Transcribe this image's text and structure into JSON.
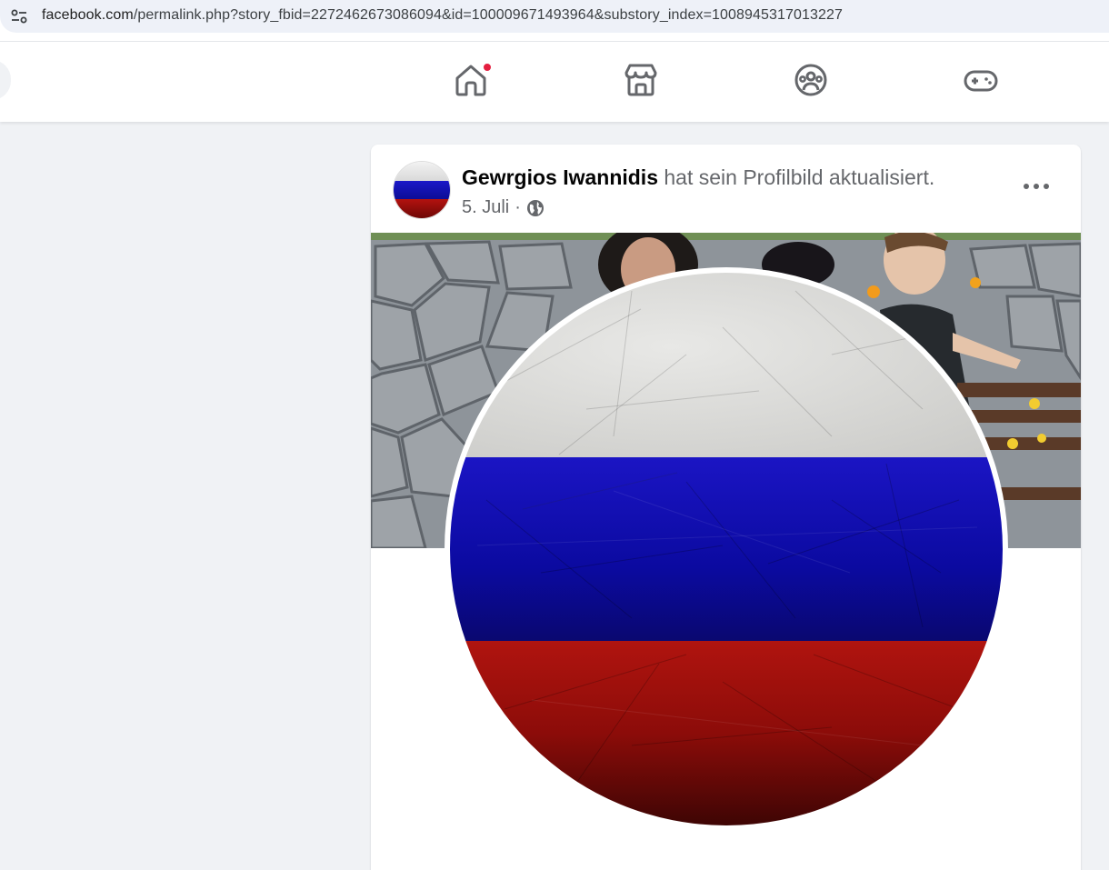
{
  "browser": {
    "url_host": "facebook.com",
    "url_path": "/permalink.php?story_fbid=2272462673086094&id=100009671493964&substory_index=1008945317013227",
    "site_info_icon": "tune-icon"
  },
  "nav": {
    "items": [
      {
        "name": "home",
        "icon": "home-icon",
        "notification": true
      },
      {
        "name": "marketplace",
        "icon": "marketplace-icon",
        "notification": false
      },
      {
        "name": "groups",
        "icon": "groups-icon",
        "notification": false
      },
      {
        "name": "gaming",
        "icon": "gaming-icon",
        "notification": false
      }
    ],
    "notification_color": "#e41e3f"
  },
  "post": {
    "author": "Gewrgios Iwannidis",
    "action": "hat sein Profilbild aktualisiert.",
    "date": "5. Juli",
    "separator": "·",
    "audience_icon": "globe-icon",
    "more_icon": "more-options-icon"
  },
  "profile_picture": {
    "subject": "Russian flag, scratched grunge texture",
    "stripes": [
      "#e0e0de",
      "#1712b8",
      "#9d100c"
    ]
  }
}
